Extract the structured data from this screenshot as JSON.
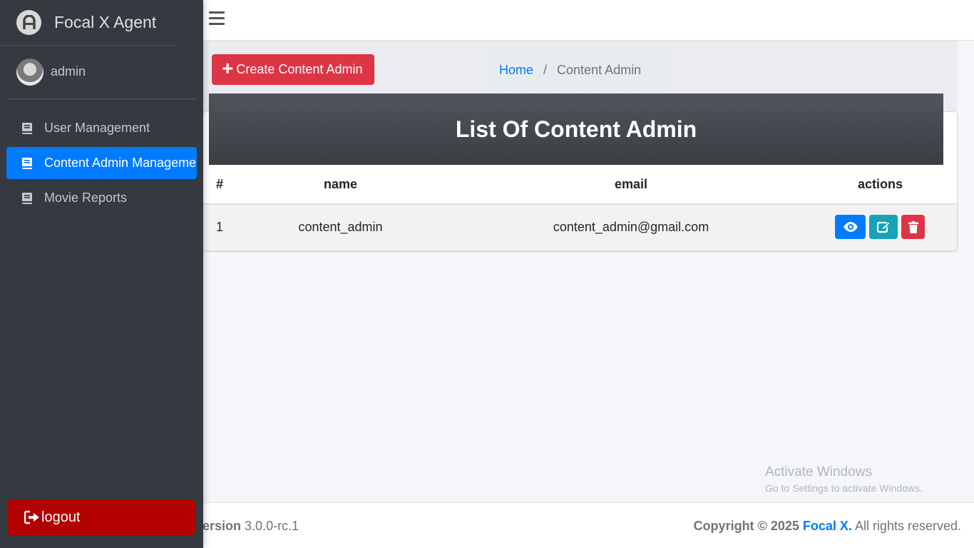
{
  "brand": {
    "name": "Focal X Agent",
    "logo_icon": "brand-logo-icon"
  },
  "user": {
    "name": "admin"
  },
  "sidebar": {
    "items": [
      {
        "label": "User Management",
        "icon": "book-icon",
        "active": false
      },
      {
        "label": "Content Admin Management",
        "icon": "book-icon",
        "active": true
      },
      {
        "label": "Movie Reports",
        "icon": "book-icon",
        "active": false
      }
    ],
    "logout_label": "logout"
  },
  "topbar": {
    "menu_icon": "hamburger-icon"
  },
  "header": {
    "create_button_label": "Create Content Admin",
    "breadcrumb": {
      "home": "Home",
      "separator": "/",
      "current": "Content Admin"
    }
  },
  "card": {
    "title": "List Of Content Admin",
    "columns": [
      "#",
      "name",
      "email",
      "actions"
    ],
    "rows": [
      {
        "num": "1",
        "name": "content_admin",
        "email": "content_admin@gmail.com"
      }
    ]
  },
  "watermark": {
    "line1": "Activate Windows",
    "line2": "Go to Settings to activate Windows."
  },
  "footer": {
    "version_label": "Version",
    "version_value": "3.0.0-rc.1",
    "copyright_prefix": "Copyright © 2025",
    "copyright_brand": "Focal X.",
    "copyright_suffix": "All rights reserved."
  },
  "colors": {
    "sidebar_bg": "#343a40",
    "active_item": "#007bff",
    "create_button": "#dc3545",
    "logout_button": "#b30000",
    "view_button": "#007bff",
    "edit_button": "#17a2b8",
    "delete_button": "#dc3545"
  }
}
